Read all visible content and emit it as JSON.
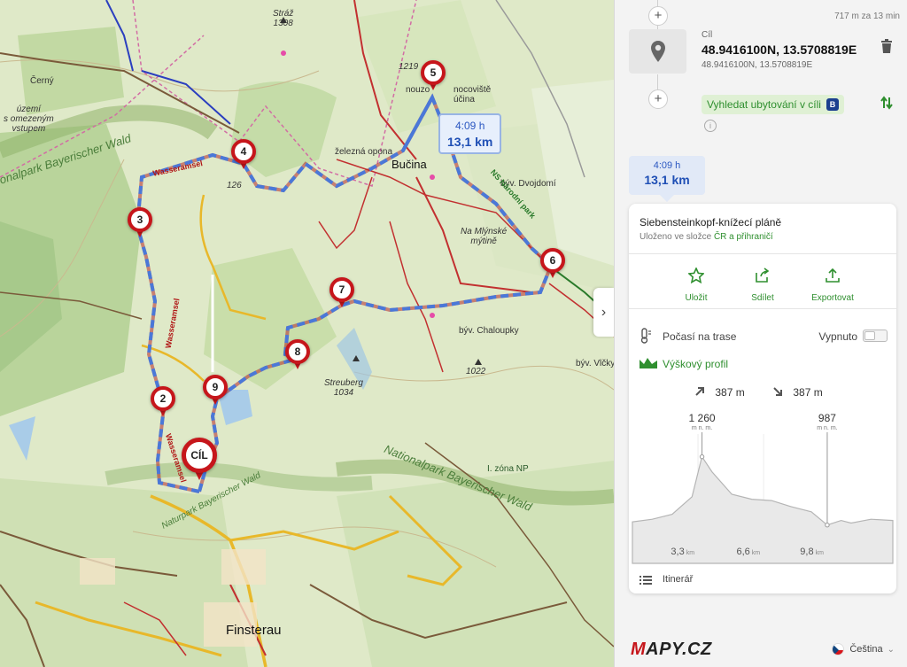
{
  "map": {
    "labels": {
      "straz": "Stráž",
      "straz_elev": "1308",
      "elev_1219": "1219",
      "nouzove": "nouzo",
      "nocoviste": "nocoviště",
      "bucina_label": "účina",
      "zelezna_opona": "železná opona",
      "bucina": "Bučina",
      "byv_dvojdomi": "býv. Dvojdomí",
      "na_mlynske": "Na Mlýnské",
      "mytine": "mýtině",
      "narodni_park": "NS Národní park",
      "byv_chaloupky": "býv. Chaloupky",
      "streuberg": "Streuberg",
      "streuberg_elev": "1034",
      "elev_1022": "1022",
      "elev_126": "126",
      "nationalpark_nw": "onalpark Bayerischer Wald",
      "nationalpark_se": "Nationalpark Bayerischer Wald",
      "naturpark": "Naturpark Bayerischer Wald",
      "zona": "I. zóna NP",
      "wasseramsel_1": "Wasseramsel",
      "wasseramsel_2": "Wasseramsel",
      "wasseramsel_3": "Wasseramsel",
      "uzemi_1": "území",
      "uzemi_2": "s omezeným",
      "uzemi_3": "vstupem",
      "cerny": "Černý",
      "finsterau": "Finsterau",
      "bystrina": "Černý",
      "vlcky": "býv. Vlčky"
    },
    "route_bubble": {
      "time": "4:09 h",
      "distance": "13,1 km"
    },
    "waypoints": [
      "2",
      "3",
      "4",
      "5",
      "6",
      "7",
      "8",
      "9"
    ],
    "goal_label": "CÍL"
  },
  "panel": {
    "segment_info": "717 m za 13 min",
    "goal": {
      "caption": "Cíl",
      "coords": "48.9416100N, 13.5708819E",
      "coords_sub": "48.9416100N, 13.5708819E"
    },
    "accommodation_button": "Vyhledat ubytování v cíli",
    "accommodation_badge": "B",
    "summary": {
      "time": "4:09 h",
      "distance": "13,1 km"
    },
    "route_card": {
      "title": "Siebensteinkopf-knížecí pláně",
      "folder_prefix": "Uloženo ve složce",
      "folder_link": "ČR a přihraničí",
      "actions": {
        "save": "Uložit",
        "share": "Sdílet",
        "export": "Exportovat"
      },
      "weather_label": "Počasí na trase",
      "weather_state": "Vypnuto",
      "elevation_label": "Výškový profil",
      "ascent": "387 m",
      "descent": "387 m",
      "max_elev": "1 260",
      "max_unit": "m n. m.",
      "min_elev": "987",
      "min_unit": "m n. m.",
      "km_ticks": [
        "3,3",
        "6,6",
        "9,8"
      ],
      "km_unit": "km",
      "itinerary": "Itinerář"
    },
    "language": "Čeština",
    "logo": {
      "m": "M",
      "rest": "APY.CZ"
    }
  },
  "colors": {
    "route": "#4a78d8",
    "pin": "#c6161b",
    "accent_green": "#2f8f2f",
    "map_bg": "#dfe9c8",
    "forest": "#b9d49b"
  },
  "chart_data": {
    "type": "area",
    "title": "Výškový profil",
    "x": [
      0,
      1,
      2,
      3,
      3.5,
      4,
      5,
      6,
      7,
      8,
      9,
      9.8,
      10.5,
      11,
      12,
      13.1
    ],
    "y": [
      1000,
      1010,
      1030,
      1100,
      1260,
      1200,
      1110,
      1090,
      1085,
      1060,
      1040,
      987,
      1005,
      995,
      1010,
      1005
    ],
    "xlabel": "km",
    "ylabel": "m n. m.",
    "x_ticks": [
      3.3,
      6.6,
      9.8
    ],
    "grid": true
  }
}
